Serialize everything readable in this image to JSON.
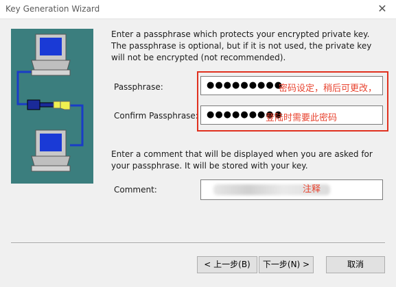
{
  "window": {
    "title": "Key Generation Wizard",
    "close_glyph": "✕"
  },
  "intro_text": "Enter a passphrase which protects your encrypted private key.  The passphrase is optional, but if it is not used, the private key will not be encrypted (not recommended).",
  "passphrase": {
    "label": "Passphrase:",
    "value": "●●●●●●●●●",
    "note": "密码设定，稍后可更改，"
  },
  "confirm": {
    "label": "Confirm Passphrase:",
    "value": "●●●●●●●●●",
    "note": "登陆时需要此密码"
  },
  "comment_text": "Enter a comment that will be displayed when you are asked for your passphrase. It will be stored with your key.",
  "comment": {
    "label": "Comment:",
    "note": "注释"
  },
  "buttons": {
    "back": "< 上一步(B)",
    "next": "下一步(N) >",
    "cancel": "取消"
  },
  "colors": {
    "art_background": "#3b7e7e",
    "annotation_red": "#e0301e"
  },
  "icons": [
    "computer-icon",
    "key-icon",
    "computer-icon"
  ]
}
